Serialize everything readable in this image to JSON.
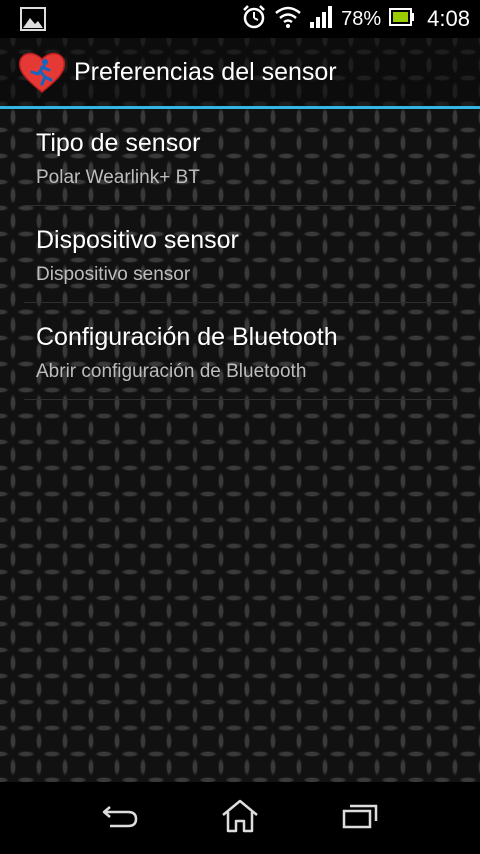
{
  "status_bar": {
    "battery_percent": "78%",
    "time": "4:08",
    "icons": [
      "image-notification-icon",
      "alarm-icon",
      "wifi-icon",
      "signal-icon",
      "battery-icon"
    ]
  },
  "action_bar": {
    "title": "Preferencias del sensor",
    "icon": "heart-runner-icon"
  },
  "preferences": [
    {
      "title": "Tipo de sensor",
      "summary": "Polar Wearlink+ BT"
    },
    {
      "title": "Dispositivo sensor",
      "summary": "Dispositivo sensor"
    },
    {
      "title": "Configuración de Bluetooth",
      "summary": "Abrir configuración de Bluetooth"
    }
  ],
  "nav_bar": {
    "icons": [
      "back-icon",
      "home-icon",
      "recents-icon"
    ]
  },
  "colors": {
    "accent": "#33b5e5",
    "battery": "#99cc00"
  }
}
